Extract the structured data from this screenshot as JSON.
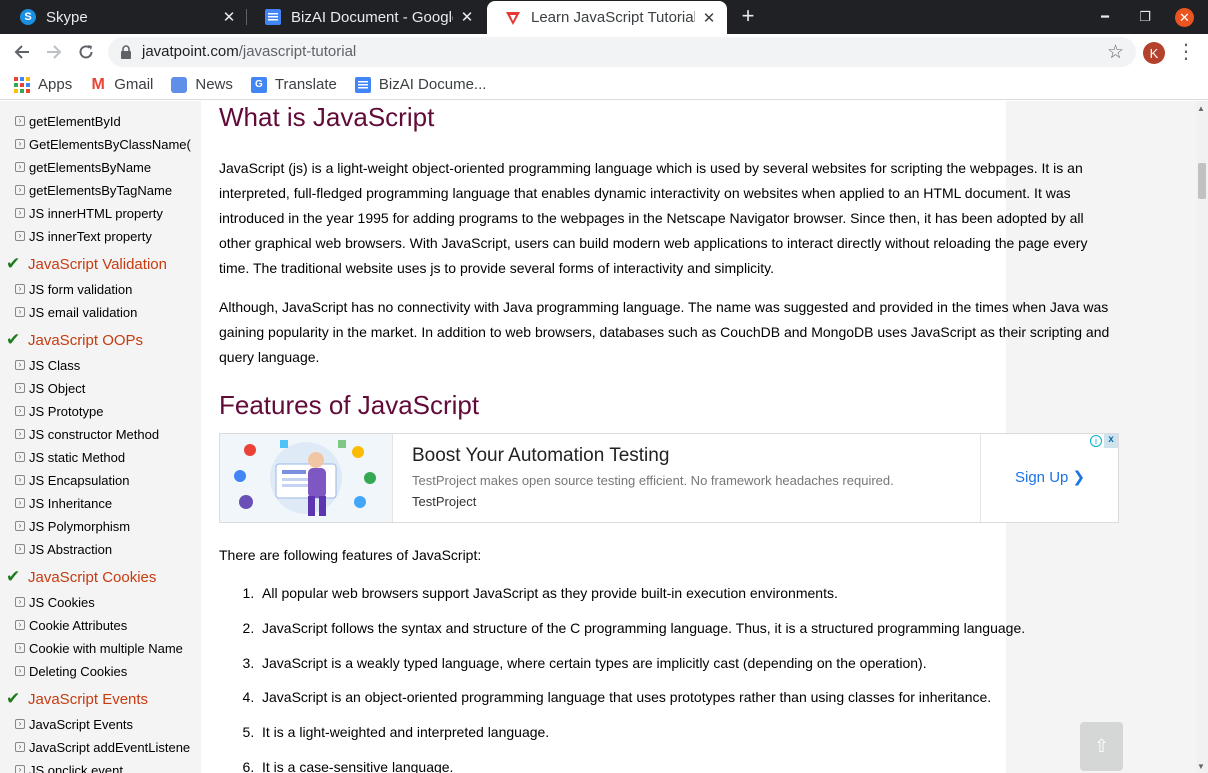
{
  "tabs": [
    {
      "title": "Skype",
      "favicon": "skype-icon",
      "favicon_letter": "S"
    },
    {
      "title": "BizAI Document - Google Docs",
      "favicon": "docs-icon"
    },
    {
      "title": "Learn JavaScript Tutorial - javatpoint",
      "favicon": "javatpoint-icon",
      "active": true
    }
  ],
  "toolbar": {
    "url_host": "javatpoint.com",
    "url_path": "/javascript-tutorial",
    "avatar_letter": "K"
  },
  "bookmarks": [
    {
      "label": "Apps",
      "icon": "apps-grid-icon"
    },
    {
      "label": "Gmail",
      "icon": "gmail-icon"
    },
    {
      "label": "News",
      "icon": "news-icon"
    },
    {
      "label": "Translate",
      "icon": "translate-icon"
    },
    {
      "label": "BizAI Docume...",
      "icon": "docs-icon"
    }
  ],
  "sidebar": {
    "groups": [
      {
        "items": [
          "getElementById",
          "GetElementsByClassName(",
          "getElementsByName",
          "getElementsByTagName",
          "JS innerHTML property",
          "JS innerText property"
        ]
      },
      {
        "heading": "JavaScript Validation",
        "items": [
          "JS form validation",
          "JS email validation"
        ]
      },
      {
        "heading": "JavaScript OOPs",
        "items": [
          "JS Class",
          "JS Object",
          "JS Prototype",
          "JS constructor Method",
          "JS static Method",
          "JS Encapsulation",
          "JS Inheritance",
          "JS Polymorphism",
          "JS Abstraction"
        ]
      },
      {
        "heading": "JavaScript Cookies",
        "items": [
          "JS Cookies",
          "Cookie Attributes",
          "Cookie with multiple Name",
          "Deleting Cookies"
        ]
      },
      {
        "heading": "JavaScript Events",
        "items": [
          "JavaScript Events",
          "JavaScript addEventListene",
          "JS onclick event"
        ]
      }
    ]
  },
  "content": {
    "h_what": "What is JavaScript",
    "p1": "JavaScript (js) is a light-weight object-oriented programming language which is used by several websites for scripting the webpages. It is an interpreted, full-fledged programming language that enables dynamic interactivity on websites when applied to an HTML document. It was introduced in the year 1995 for adding programs to the webpages in the Netscape Navigator browser. Since then, it has been adopted by all other graphical web browsers. With JavaScript, users can build modern web applications to interact directly without reloading the page every time. The traditional website uses js to provide several forms of interactivity and simplicity.",
    "p2": "Although, JavaScript has no connectivity with Java programming language. The name was suggested and provided in the times when Java was gaining popularity in the market. In addition to web browsers, databases such as CouchDB and MongoDB uses JavaScript as their scripting and query language.",
    "h_features": "Features of JavaScript",
    "features_intro": "There are following features of JavaScript:",
    "features": [
      "All popular web browsers support JavaScript as they provide built-in execution environments.",
      "JavaScript follows the syntax and structure of the C programming language. Thus, it is a structured programming language.",
      "JavaScript is a weakly typed language, where certain types are implicitly cast (depending on the operation).",
      "JavaScript is an object-oriented programming language that uses prototypes rather than using classes for inheritance.",
      "It is a light-weighted and interpreted language.",
      "It is a case-sensitive language."
    ]
  },
  "ad": {
    "title": "Boost Your Automation Testing",
    "description": "TestProject makes open source testing efficient. No framework headaches required.",
    "brand": "TestProject",
    "cta": "Sign Up",
    "info_glyph": "i",
    "close_glyph": "x"
  },
  "controls": {
    "back_to_top_glyph": "⇧"
  },
  "colors": {
    "heading": "#610b38",
    "sidebar_heading": "#c73b10",
    "check": "#1e7b1e",
    "link_blue": "#1a73e8"
  }
}
